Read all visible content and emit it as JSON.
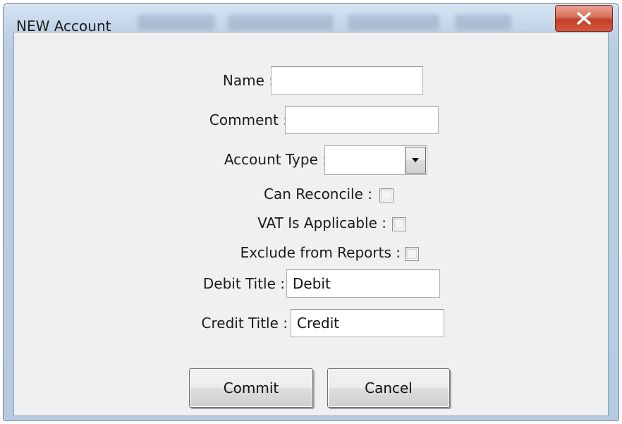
{
  "window": {
    "title": "NEW Account"
  },
  "form": {
    "name": {
      "label": "Name :",
      "value": ""
    },
    "comment": {
      "label": "Comment :",
      "value": ""
    },
    "account_type": {
      "label": "Account Type :",
      "value": ""
    },
    "can_reconcile": {
      "label": "Can Reconcile :",
      "checked": false
    },
    "vat_applicable": {
      "label": "VAT Is Applicable :",
      "checked": false
    },
    "exclude_reports": {
      "label": "Exclude from Reports :",
      "checked": false
    },
    "debit_title": {
      "label": "Debit Title :",
      "value": "Debit"
    },
    "credit_title": {
      "label": "Credit Title :",
      "value": "Credit"
    }
  },
  "buttons": {
    "commit": "Commit",
    "cancel": "Cancel"
  },
  "icons": {
    "close": "close-icon",
    "dropdown": "chevron-down-icon"
  },
  "colors": {
    "close_button": "#c2402a",
    "client_background": "#f0f0f0",
    "frame": "#b9cde3"
  }
}
